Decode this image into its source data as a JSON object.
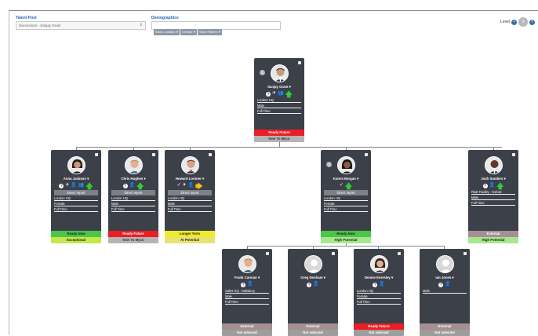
{
  "filters": {
    "talent_pool_label": "Talent Pool",
    "talent_pool_value": "Successors - Sanjay Grant",
    "demographics_label": "Demographics",
    "demographic_tags": [
      "Work Location",
      "Gender",
      "Work Pattern"
    ]
  },
  "level": {
    "label": "Level",
    "value": "3",
    "minus": "−",
    "plus": "+"
  },
  "cards": {
    "root": {
      "badge": "1",
      "name": "Sanjay Grant ▾",
      "rows": [
        "London HQ",
        "Male",
        "Full Time"
      ],
      "status1": "Ready Future",
      "status2": "New To Myco"
    },
    "anna": {
      "name": "Anna Jackson ▾",
      "direct": "Direct report",
      "rows": [
        "London HQ",
        "Female",
        "Full Time"
      ],
      "status1": "Ready Now",
      "status2": "Exceptional"
    },
    "chris": {
      "name": "Chris Hughes ▾",
      "direct": "Direct report",
      "rows": [
        "London HQ",
        "Male",
        "Full Time"
      ],
      "status1": "Ready Future",
      "status2": "New To Myco"
    },
    "howard": {
      "name": "Howard Lorimer ▾",
      "direct": "Direct report",
      "rows": [
        "London HQ",
        "Male",
        "Full Time"
      ],
      "status1": "Longer Term",
      "status2": "At Potential"
    },
    "karen": {
      "badge": "4",
      "name": "Karen Morgan ▾",
      "direct": "Direct report",
      "rows": [
        "London HQ",
        "Female",
        "Full Time"
      ],
      "status1": "Ready Now",
      "status2": "High Potential"
    },
    "josh": {
      "name": "Josh Sanders ▾",
      "rows": [
        "R&D Facility - Oxford",
        "Male",
        "Full Time"
      ],
      "status1": "External",
      "status2": "High Potential"
    },
    "frank": {
      "name": "Frank Carman ▾",
      "rows": [
        "Sales HQ - Salisbury",
        "Male",
        "Full Time"
      ],
      "status1": "External",
      "status2": "Not selected"
    },
    "greg": {
      "name": "Greg Denham ▾",
      "rows": [],
      "status1": "External",
      "status2": "Not selected"
    },
    "denise": {
      "name": "Denise Eversley ▾",
      "rows": [
        "London HQ",
        "Female",
        "Full Time"
      ],
      "status1": "Ready Future",
      "status2": "Not selected"
    },
    "ian": {
      "name": "Ian Jones ▾",
      "rows": [
        "Male"
      ],
      "status1": "External",
      "status2": "Not selected"
    }
  },
  "colors": {
    "card_bg": "#3c4049",
    "ready_now": "#4cc548",
    "ready_future": "#ec1d23",
    "longer_term": "#f0eb2c",
    "accent": "#3a6ea8"
  }
}
